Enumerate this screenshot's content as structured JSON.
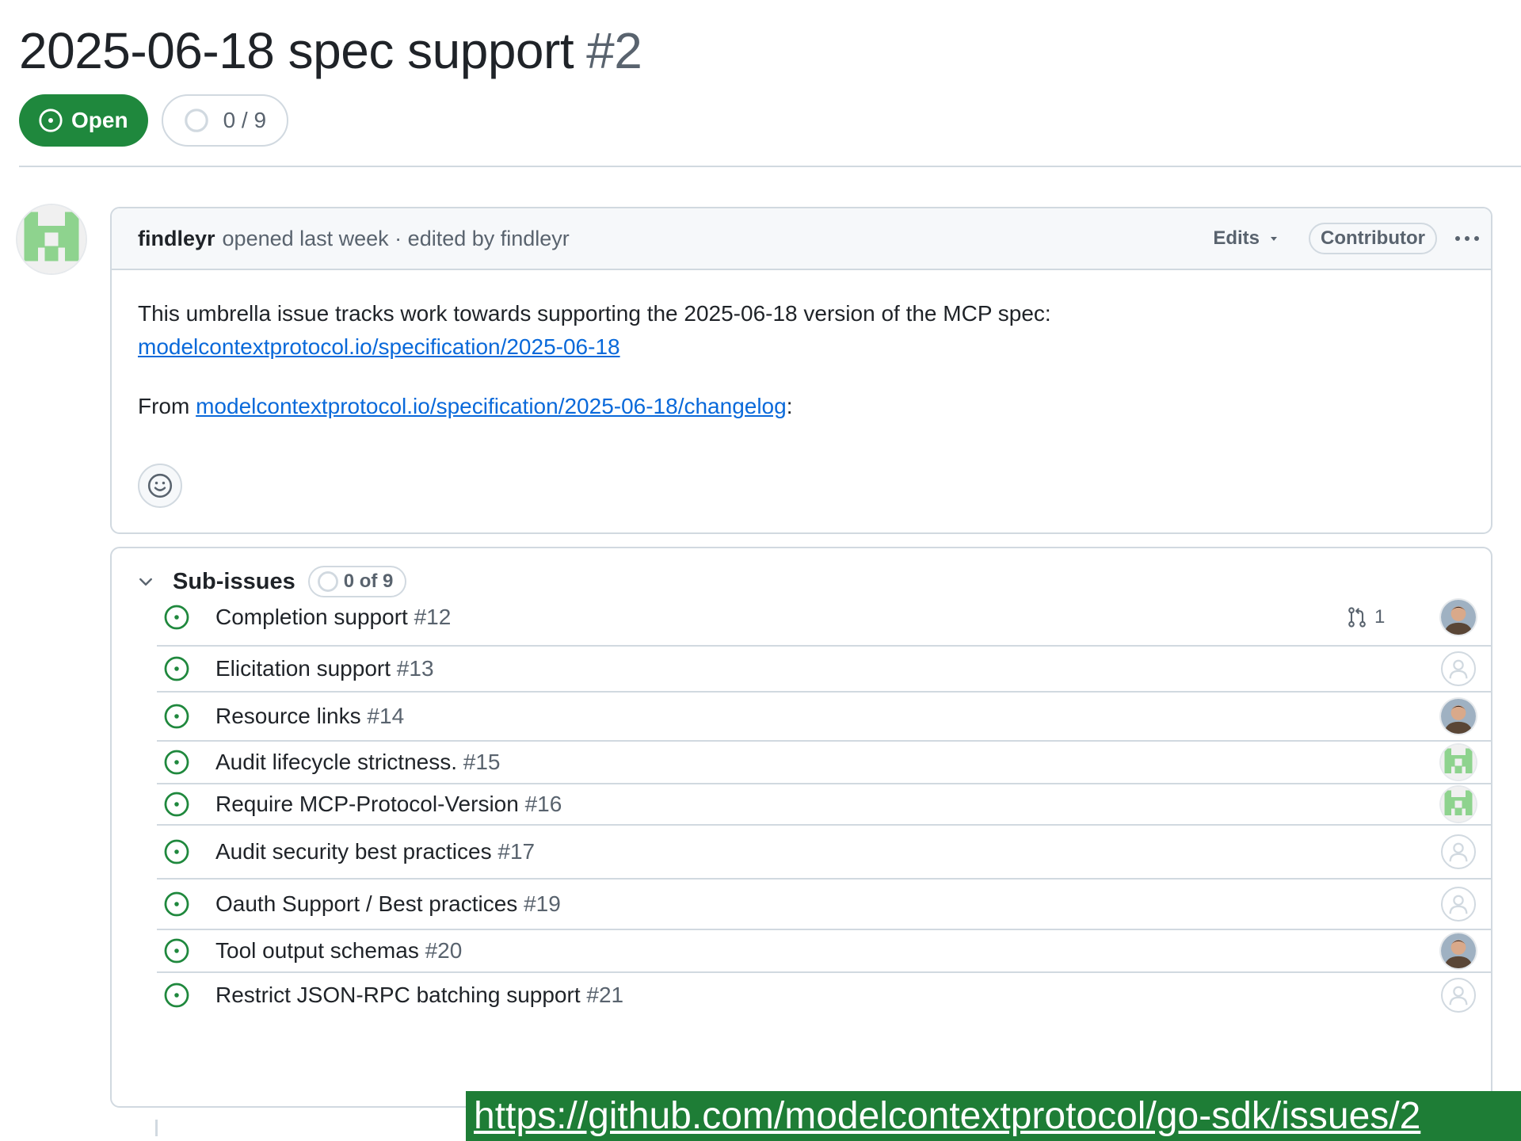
{
  "issue": {
    "title": "2025-06-18 spec support",
    "number": "#2",
    "state_label": "Open",
    "progress_label": "0 / 9"
  },
  "comment": {
    "author": "findleyr",
    "meta": "opened last week · edited by findleyr",
    "edits_label": "Edits",
    "role_badge": "Contributor",
    "body_intro": "This umbrella issue tracks work towards supporting the 2025-06-18 version of the MCP spec:",
    "spec_link": "modelcontextprotocol.io/specification/2025-06-18",
    "from_label": "From",
    "changelog_link": "modelcontextprotocol.io/specification/2025-06-18/changelog",
    "colon": ":"
  },
  "sub_issues": {
    "title": "Sub-issues",
    "count_label": "0 of 9",
    "items": [
      {
        "title": "Completion support",
        "number": "#12",
        "linked_prs": "1",
        "assignee": "photo"
      },
      {
        "title": "Elicitation support",
        "number": "#13",
        "assignee": "none"
      },
      {
        "title": "Resource links",
        "number": "#14",
        "assignee": "photo"
      },
      {
        "title": "Audit lifecycle strictness.",
        "number": "#15",
        "assignee": "identicon"
      },
      {
        "title": "Require MCP-Protocol-Version",
        "number": "#16",
        "assignee": "identicon"
      },
      {
        "title": "Audit security best practices",
        "number": "#17",
        "assignee": "none"
      },
      {
        "title": "Oauth Support / Best practices",
        "number": "#19",
        "assignee": "none"
      },
      {
        "title": "Tool output schemas",
        "number": "#20",
        "assignee": "photo"
      },
      {
        "title": "Restrict JSON-RPC batching support",
        "number": "#21",
        "assignee": "none"
      }
    ]
  },
  "overlay": {
    "url": "https://github.com/modelcontextprotocol/go-sdk/issues/2"
  },
  "icons": {
    "state": "issue-opened-icon",
    "progress": "progress-circle-icon",
    "chevron": "chevron-down-icon",
    "linked_pr": "git-pull-request-icon",
    "reaction": "smiley-icon",
    "more": "kebab-horizontal-icon"
  },
  "colors": {
    "open_green": "#1f883d",
    "link_blue": "#0969da",
    "muted_text": "#59636e",
    "border": "#d1d9e0",
    "overlay_green": "#1e7d36",
    "identicon_green": "#8ed38e"
  }
}
